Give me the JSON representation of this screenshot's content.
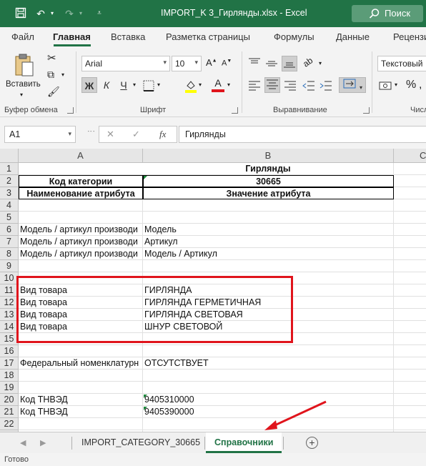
{
  "window": {
    "title": "IMPORT_K 3_Гирлянды.xlsx  -  Excel",
    "search_label": "Поиск"
  },
  "colors": {
    "accent": "#217346",
    "highlight_box": "#e0141c"
  },
  "ribbon": {
    "tabs": [
      "Файл",
      "Главная",
      "Вставка",
      "Разметка страницы",
      "Формулы",
      "Данные",
      "Рецензи"
    ],
    "active_tab": "Главная",
    "clipboard": {
      "paste_label": "Вставить",
      "group_label": "Буфер обмена"
    },
    "font": {
      "family": "Arial",
      "size": "10",
      "group_label": "Шрифт",
      "bold": "Ж",
      "italic": "К",
      "underline": "Ч"
    },
    "alignment": {
      "group_label": "Выравнивание"
    },
    "number": {
      "format": "Текстовый",
      "group_label": "Числ"
    }
  },
  "formula_bar": {
    "name_box": "A1",
    "fx": "fx",
    "value": "Гирлянды"
  },
  "grid": {
    "columns": [
      "A",
      "B",
      "C"
    ],
    "rows": [
      {
        "n": "1",
        "a": "",
        "b": "Гирлянды"
      },
      {
        "n": "2",
        "a": "Код категории",
        "b": "30665"
      },
      {
        "n": "3",
        "a": "Наименование атрибута",
        "b": "Значение атрибута"
      },
      {
        "n": "4",
        "a": "",
        "b": ""
      },
      {
        "n": "5",
        "a": "",
        "b": ""
      },
      {
        "n": "6",
        "a": "Модель / артикул производи",
        "b": "Модель"
      },
      {
        "n": "7",
        "a": "Модель / артикул производи",
        "b": "Артикул"
      },
      {
        "n": "8",
        "a": "Модель / артикул производи",
        "b": "Модель / Артикул"
      },
      {
        "n": "9",
        "a": "",
        "b": ""
      },
      {
        "n": "10",
        "a": "",
        "b": ""
      },
      {
        "n": "11",
        "a": "Вид товара",
        "b": "ГИРЛЯНДА"
      },
      {
        "n": "12",
        "a": "Вид товара",
        "b": "ГИРЛЯНДА ГЕРМЕТИЧНАЯ"
      },
      {
        "n": "13",
        "a": "Вид товара",
        "b": "ГИРЛЯНДА СВЕТОВАЯ"
      },
      {
        "n": "14",
        "a": "Вид товара",
        "b": "ШНУР СВЕТОВОЙ"
      },
      {
        "n": "15",
        "a": "",
        "b": ""
      },
      {
        "n": "16",
        "a": "",
        "b": ""
      },
      {
        "n": "17",
        "a": "Федеральный номенклатурн",
        "b": "ОТСУТСТВУЕТ"
      },
      {
        "n": "18",
        "a": "",
        "b": ""
      },
      {
        "n": "19",
        "a": "",
        "b": ""
      },
      {
        "n": "20",
        "a": "Код ТНВЭД",
        "b": "9405310000"
      },
      {
        "n": "21",
        "a": "Код ТНВЭД",
        "b": "9405390000"
      },
      {
        "n": "22",
        "a": "",
        "b": ""
      },
      {
        "n": "23",
        "a": "",
        "b": ""
      }
    ]
  },
  "sheets": {
    "tabs": [
      "IMPORT_CATEGORY_30665",
      "Справочники"
    ],
    "active": "Справочники"
  },
  "status": {
    "text": "Готово"
  }
}
